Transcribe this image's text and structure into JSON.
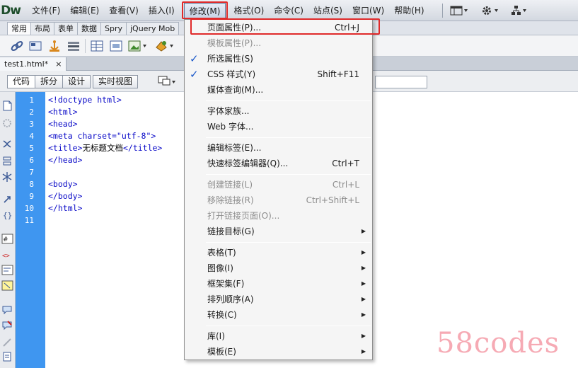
{
  "app": {
    "logo": "Dw"
  },
  "menubar": {
    "items": [
      "文件(F)",
      "编辑(E)",
      "查看(V)",
      "插入(I)",
      "修改(M)",
      "格式(O)",
      "命令(C)",
      "站点(S)",
      "窗口(W)",
      "帮助(H)"
    ],
    "active": "修改(M)"
  },
  "insert_tabs": [
    "常用",
    "布局",
    "表单",
    "数据",
    "Spry",
    "jQuery Mob"
  ],
  "document": {
    "tab_name": "test1.html*",
    "close_glyph": "×"
  },
  "view_buttons": [
    "代码",
    "拆分",
    "设计",
    "实时视图"
  ],
  "editor": {
    "line_numbers": [
      "1",
      "2",
      "3",
      "4",
      "5",
      "6",
      "7",
      "8",
      "9",
      "10",
      "11"
    ],
    "lines": [
      "<!doctype html>",
      "<html>",
      "<head>",
      "<meta charset=\"utf-8\">",
      {
        "pre": "<title>",
        "text": "无标题文档",
        "post": "</title>"
      },
      "</head>",
      "",
      "<body>",
      "</body>",
      "</html>",
      ""
    ]
  },
  "modify_menu": {
    "items": [
      {
        "label": "页面属性(P)...",
        "shortcut": "Ctrl+J",
        "disabled": false
      },
      {
        "label": "模板属性(P)...",
        "disabled": true
      },
      {
        "label": "所选属性(S)",
        "checked": true
      },
      {
        "label": "CSS 样式(Y)",
        "shortcut": "Shift+F11",
        "checked": true
      },
      {
        "label": "媒体查询(M)..."
      },
      {
        "label": "字体家族..."
      },
      {
        "label": "Web 字体..."
      },
      {
        "label": "编辑标签(E)..."
      },
      {
        "label": "快速标签编辑器(Q)...",
        "shortcut": "Ctrl+T"
      },
      {
        "label": "创建链接(L)",
        "shortcut": "Ctrl+L",
        "disabled": true
      },
      {
        "label": "移除链接(R)",
        "shortcut": "Ctrl+Shift+L",
        "disabled": true
      },
      {
        "label": "打开链接页面(O)...",
        "disabled": true
      },
      {
        "label": "链接目标(G)",
        "submenu": true
      },
      {
        "label": "表格(T)",
        "submenu": true
      },
      {
        "label": "图像(I)",
        "submenu": true
      },
      {
        "label": "框架集(F)",
        "submenu": true
      },
      {
        "label": "排列顺序(A)",
        "submenu": true
      },
      {
        "label": "转换(C)",
        "submenu": true
      },
      {
        "label": "库(I)",
        "submenu": true
      },
      {
        "label": "模板(E)",
        "submenu": true
      }
    ]
  },
  "colors": {
    "gutter": "#3f96f0",
    "highlight": "#e02a2a",
    "code_tag": "#0a0ac8",
    "check": "#1a58c9"
  },
  "watermark": "58codes"
}
